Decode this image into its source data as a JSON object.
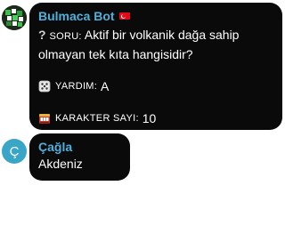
{
  "bot_message": {
    "sender": "Bulmaca Bot",
    "flag_icon": "turkey-flag-icon",
    "question_prefix": "SORU:",
    "question_text": "Aktif bir volkanik dağa sahip olmayan tek kıta hangisidir?",
    "hint_label": "YARDIM:",
    "hint_value": "A",
    "count_label": "KARAKTER SAYI:",
    "count_value": "10"
  },
  "user_message": {
    "sender": "Çağla",
    "avatar_initial": "Ç",
    "text": "Akdeniz"
  },
  "colors": {
    "bubble": "#0a0a0a",
    "name": "#4fb0dc",
    "user_avatar": "#3aa6c7"
  }
}
